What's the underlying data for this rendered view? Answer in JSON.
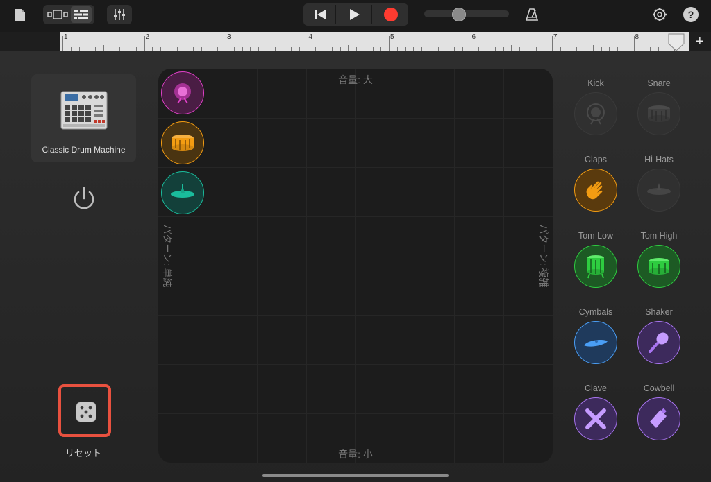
{
  "toolbar": {
    "icons": [
      "document-icon",
      "view-tracks-icon",
      "track-view-icon",
      "mixer-icon",
      "rewind-icon",
      "play-icon",
      "record-icon",
      "master-volume-slider",
      "metronome-icon",
      "settings-icon",
      "help-icon"
    ],
    "record_color": "#ff3b30"
  },
  "ruler": {
    "marks": [
      "1",
      "2",
      "3",
      "4",
      "5",
      "6",
      "7",
      "8"
    ],
    "add_label": "+"
  },
  "kit": {
    "name": "Classic Drum Machine"
  },
  "pad": {
    "top_label": "音量: 大",
    "bottom_label": "音量: 小",
    "left_label": "パターン: 単純",
    "right_label": "パターン: 複雑"
  },
  "instruments": [
    {
      "label": "Kick",
      "color": "#3a3a3a",
      "active": false,
      "icon": "kick-drum-icon"
    },
    {
      "label": "Snare",
      "color": "#3a3a3a",
      "active": false,
      "icon": "snare-drum-icon"
    },
    {
      "label": "Claps",
      "color": "#f39c12",
      "active": true,
      "icon": "clap-hand-icon"
    },
    {
      "label": "Hi-Hats",
      "color": "#3a3a3a",
      "active": false,
      "icon": "hihat-icon"
    },
    {
      "label": "Tom Low",
      "color": "#2ecc40",
      "active": true,
      "icon": "tom-low-icon"
    },
    {
      "label": "Tom High",
      "color": "#2ecc40",
      "active": true,
      "icon": "tom-high-icon"
    },
    {
      "label": "Cymbals",
      "color": "#4a9ef5",
      "active": true,
      "icon": "cymbal-icon"
    },
    {
      "label": "Shaker",
      "color": "#a874f0",
      "active": true,
      "icon": "shaker-icon"
    },
    {
      "label": "Clave",
      "color": "#a874f0",
      "active": true,
      "icon": "clave-icon"
    },
    {
      "label": "Cowbell",
      "color": "#a874f0",
      "active": true,
      "icon": "cowbell-icon"
    }
  ],
  "pad_instruments": [
    {
      "name": "kick-drum-icon",
      "color": "#e040c8"
    },
    {
      "name": "snare-drum-icon",
      "color": "#f39c12"
    },
    {
      "name": "hihat-icon",
      "color": "#1abc9c"
    }
  ],
  "reset": {
    "label": "リセット"
  }
}
